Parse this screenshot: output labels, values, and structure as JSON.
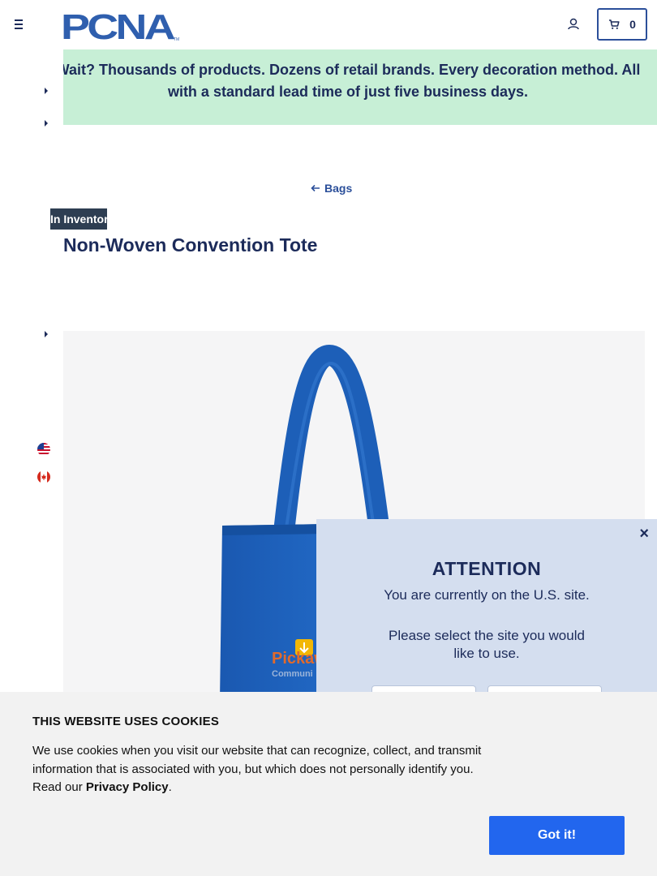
{
  "header": {
    "logo_text": "PCNA",
    "logo_tm": "TM",
    "cart_count": "0"
  },
  "promo": {
    "text": "Wait? Thousands of products. Dozens of retail brands. Every decoration method. All with a standard lead time of just five business days."
  },
  "breadcrumb": {
    "back_label": "Bags"
  },
  "product": {
    "badge": "In Inventory",
    "title": "Non-Woven Convention Tote",
    "bag_color": "#1f63c0",
    "imprint_text_1": "Pickaw",
    "imprint_text_2": "Communi"
  },
  "site_popup": {
    "close_label": "×",
    "title": "ATTENTION",
    "line1": "You are currently on the U.S. site.",
    "line2": "Please select the site you would like to use."
  },
  "cookie_banner": {
    "title": "THIS WEBSITE USES COOKIES",
    "text_before": "We use cookies when you visit our website that can recognize, collect, and transmit information that is associated with you, but which does not personally identify you. Read our ",
    "link_label": "Privacy Policy",
    "text_after": ".",
    "accept_label": "Got it!"
  },
  "colors": {
    "navy": "#1c2b5a",
    "accent_blue": "#2266ee",
    "promo_bg": "#c7efd6",
    "popup_bg": "#d4deef",
    "cookie_bg": "#f2f2f2"
  }
}
